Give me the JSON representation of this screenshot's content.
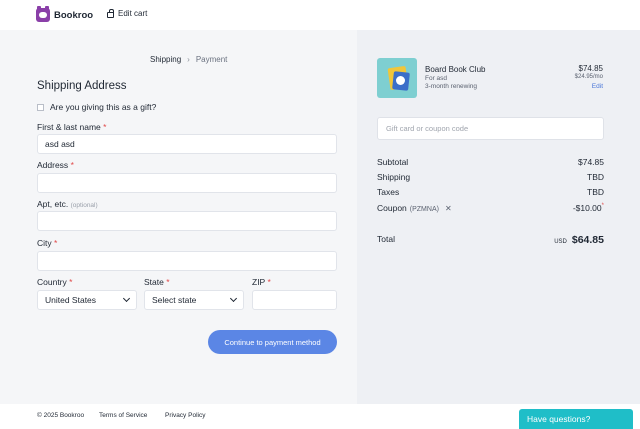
{
  "header": {
    "brand": "Bookroo",
    "edit_cart": "Edit cart"
  },
  "breadcrumbs": {
    "current": "Shipping",
    "next": "Payment",
    "separator": "›"
  },
  "form": {
    "heading": "Shipping Address",
    "gift_label": "Are you giving this as a gift?",
    "name": {
      "label": "First & last name",
      "value": "asd asd"
    },
    "address": {
      "label": "Address",
      "value": ""
    },
    "apt": {
      "label": "Apt, etc.",
      "optional": "(optional)",
      "value": ""
    },
    "city": {
      "label": "City",
      "value": ""
    },
    "country": {
      "label": "Country",
      "value": "United States"
    },
    "state": {
      "label": "State",
      "value": "Select state"
    },
    "zip": {
      "label": "ZIP",
      "value": ""
    },
    "required_mark": "*",
    "continue": "Continue to payment method"
  },
  "cart": {
    "product_name": "Board Book Club",
    "for": "For asd",
    "renewing": "3-month renewing",
    "price": "$74.85",
    "per_month": "$24.95/mo",
    "edit": "Edit",
    "coupon_placeholder": "Gift card or coupon code",
    "subtotal_label": "Subtotal",
    "subtotal": "$74.85",
    "shipping_label": "Shipping",
    "shipping": "TBD",
    "taxes_label": "Taxes",
    "taxes": "TBD",
    "coupon_label": "Coupon",
    "coupon_code": "(PZMNA)",
    "coupon_value": "-$10.00",
    "coupon_note": "*",
    "total_label": "Total",
    "currency": "USD",
    "total": "$64.85"
  },
  "footer": {
    "copyright": "© 2025 Bookroo",
    "terms": "Terms of Service",
    "privacy": "Privacy Policy",
    "help": "Have questions?"
  },
  "colors": {
    "accent": "#5b86e5",
    "brand": "#8a3fa8",
    "help": "#1fbec8",
    "required": "#e04848"
  }
}
